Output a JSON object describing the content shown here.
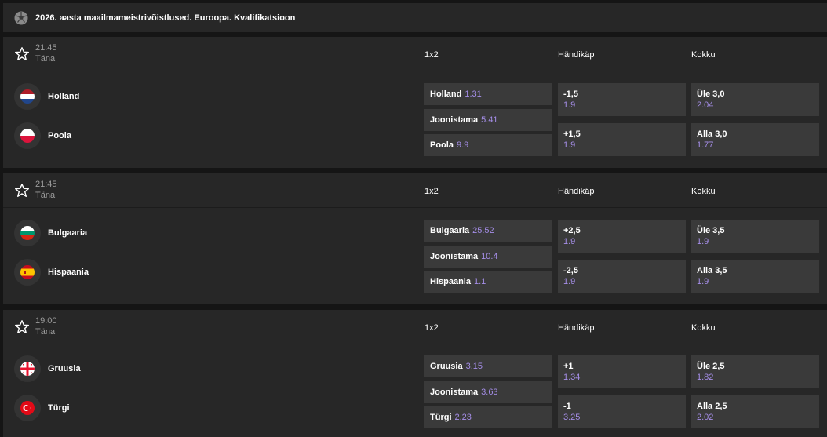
{
  "header": {
    "title": "2026. aasta maailmameistrivõistlused. Euroopa. Kvalifikatsioon",
    "icon": "football-icon"
  },
  "colors": {
    "background": "#151515",
    "panel": "#272727",
    "odd_button": "#3a3a3a",
    "odd_value": "#a58ee8",
    "muted_text": "#9c9c9c"
  },
  "matches": [
    {
      "time": "21:45",
      "day": "Täna",
      "columns": {
        "one_x_two": "1x2",
        "handicap": "Händikäp",
        "total": "Kokku"
      },
      "home": {
        "name": "Holland",
        "flag": "netherlands-flag-icon"
      },
      "away": {
        "name": "Poola",
        "flag": "poland-flag-icon"
      },
      "odds_1x2": [
        {
          "label": "Holland",
          "value": "1.31"
        },
        {
          "label": "Joonistama",
          "value": "5.41"
        },
        {
          "label": "Poola",
          "value": "9.9"
        }
      ],
      "handicap": [
        {
          "label": "-1,5",
          "value": "1.9"
        },
        {
          "label": "+1,5",
          "value": "1.9"
        }
      ],
      "total": [
        {
          "label": "Üle 3,0",
          "value": "2.04"
        },
        {
          "label": "Alla 3,0",
          "value": "1.77"
        }
      ]
    },
    {
      "time": "21:45",
      "day": "Täna",
      "columns": {
        "one_x_two": "1x2",
        "handicap": "Händikäp",
        "total": "Kokku"
      },
      "home": {
        "name": "Bulgaaria",
        "flag": "bulgaria-flag-icon"
      },
      "away": {
        "name": "Hispaania",
        "flag": "spain-flag-icon"
      },
      "odds_1x2": [
        {
          "label": "Bulgaaria",
          "value": "25.52"
        },
        {
          "label": "Joonistama",
          "value": "10.4"
        },
        {
          "label": "Hispaania",
          "value": "1.1"
        }
      ],
      "handicap": [
        {
          "label": "+2,5",
          "value": "1.9"
        },
        {
          "label": "-2,5",
          "value": "1.9"
        }
      ],
      "total": [
        {
          "label": "Üle 3,5",
          "value": "1.9"
        },
        {
          "label": "Alla 3,5",
          "value": "1.9"
        }
      ]
    },
    {
      "time": "19:00",
      "day": "Täna",
      "columns": {
        "one_x_two": "1x2",
        "handicap": "Händikäp",
        "total": "Kokku"
      },
      "home": {
        "name": "Gruusia",
        "flag": "georgia-flag-icon"
      },
      "away": {
        "name": "Türgi",
        "flag": "turkey-flag-icon"
      },
      "odds_1x2": [
        {
          "label": "Gruusia",
          "value": "3.15"
        },
        {
          "label": "Joonistama",
          "value": "3.63"
        },
        {
          "label": "Türgi",
          "value": "2.23"
        }
      ],
      "handicap": [
        {
          "label": "+1",
          "value": "1.34"
        },
        {
          "label": "-1",
          "value": "3.25"
        }
      ],
      "total": [
        {
          "label": "Üle 2,5",
          "value": "1.82"
        },
        {
          "label": "Alla 2,5",
          "value": "2.02"
        }
      ]
    }
  ]
}
